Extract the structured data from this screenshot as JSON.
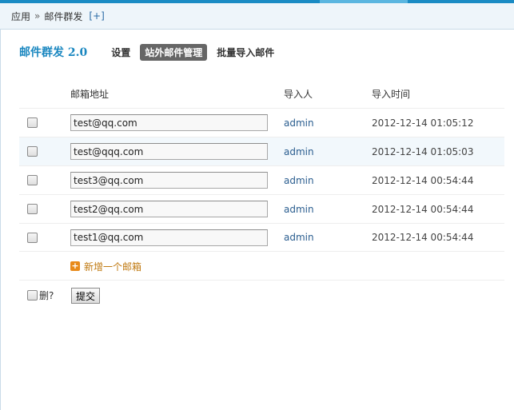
{
  "breadcrumb": {
    "root": "应用",
    "separator": "»",
    "current": "邮件群发",
    "add": "[+]"
  },
  "header": {
    "plugin_title": "邮件群发 2.0",
    "nav": [
      "设置",
      "站外邮件管理",
      "批量导入邮件"
    ],
    "active_index": 1
  },
  "table": {
    "columns": [
      "邮箱地址",
      "导入人",
      "导入时间"
    ],
    "rows": [
      {
        "email": "test@qq.com",
        "importer": "admin",
        "time": "2012-12-14 01:05:12"
      },
      {
        "email": "test@qqq.com",
        "importer": "admin",
        "time": "2012-12-14 01:05:03"
      },
      {
        "email": "test3@qq.com",
        "importer": "admin",
        "time": "2012-12-14 00:54:44"
      },
      {
        "email": "test2@qq.com",
        "importer": "admin",
        "time": "2012-12-14 00:54:44"
      },
      {
        "email": "test1@qq.com",
        "importer": "admin",
        "time": "2012-12-14 00:54:44"
      }
    ]
  },
  "add_email_label": "新增一个邮箱",
  "add_icon": "plus-square-icon",
  "delete_label": "删?",
  "submit_label": "提交",
  "colors": {
    "accent": "#1a8bc4",
    "title": "#1a87c0",
    "link": "#2a5d8f",
    "add": "#c07a12",
    "active_tab_bg": "#666666"
  }
}
